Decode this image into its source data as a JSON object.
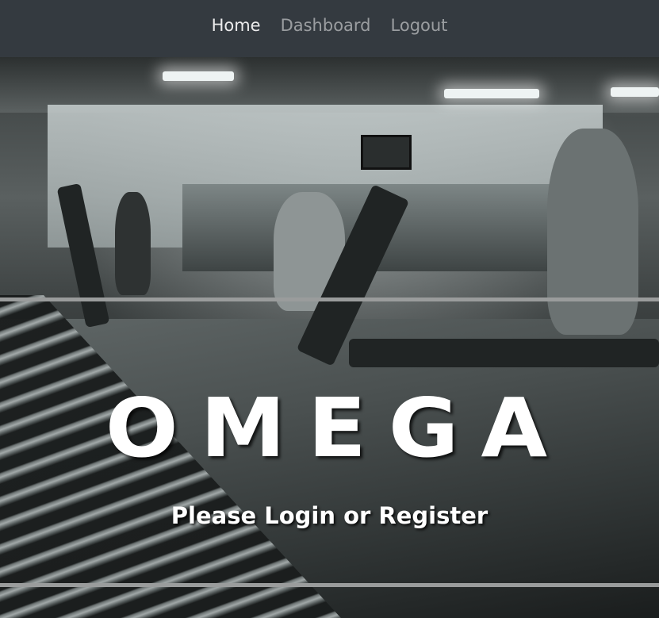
{
  "nav": {
    "items": [
      {
        "label": "Home",
        "active": true
      },
      {
        "label": "Dashboard",
        "active": false
      },
      {
        "label": "Logout",
        "active": false
      }
    ]
  },
  "hero": {
    "title": "OMEGA",
    "subtitle": "Please Login or Register",
    "background": "gym-photo"
  },
  "colors": {
    "navbar": "#343a40",
    "nav_active": "#e6e6e6",
    "nav_inactive": "#9a9da0",
    "text": "#ffffff"
  }
}
